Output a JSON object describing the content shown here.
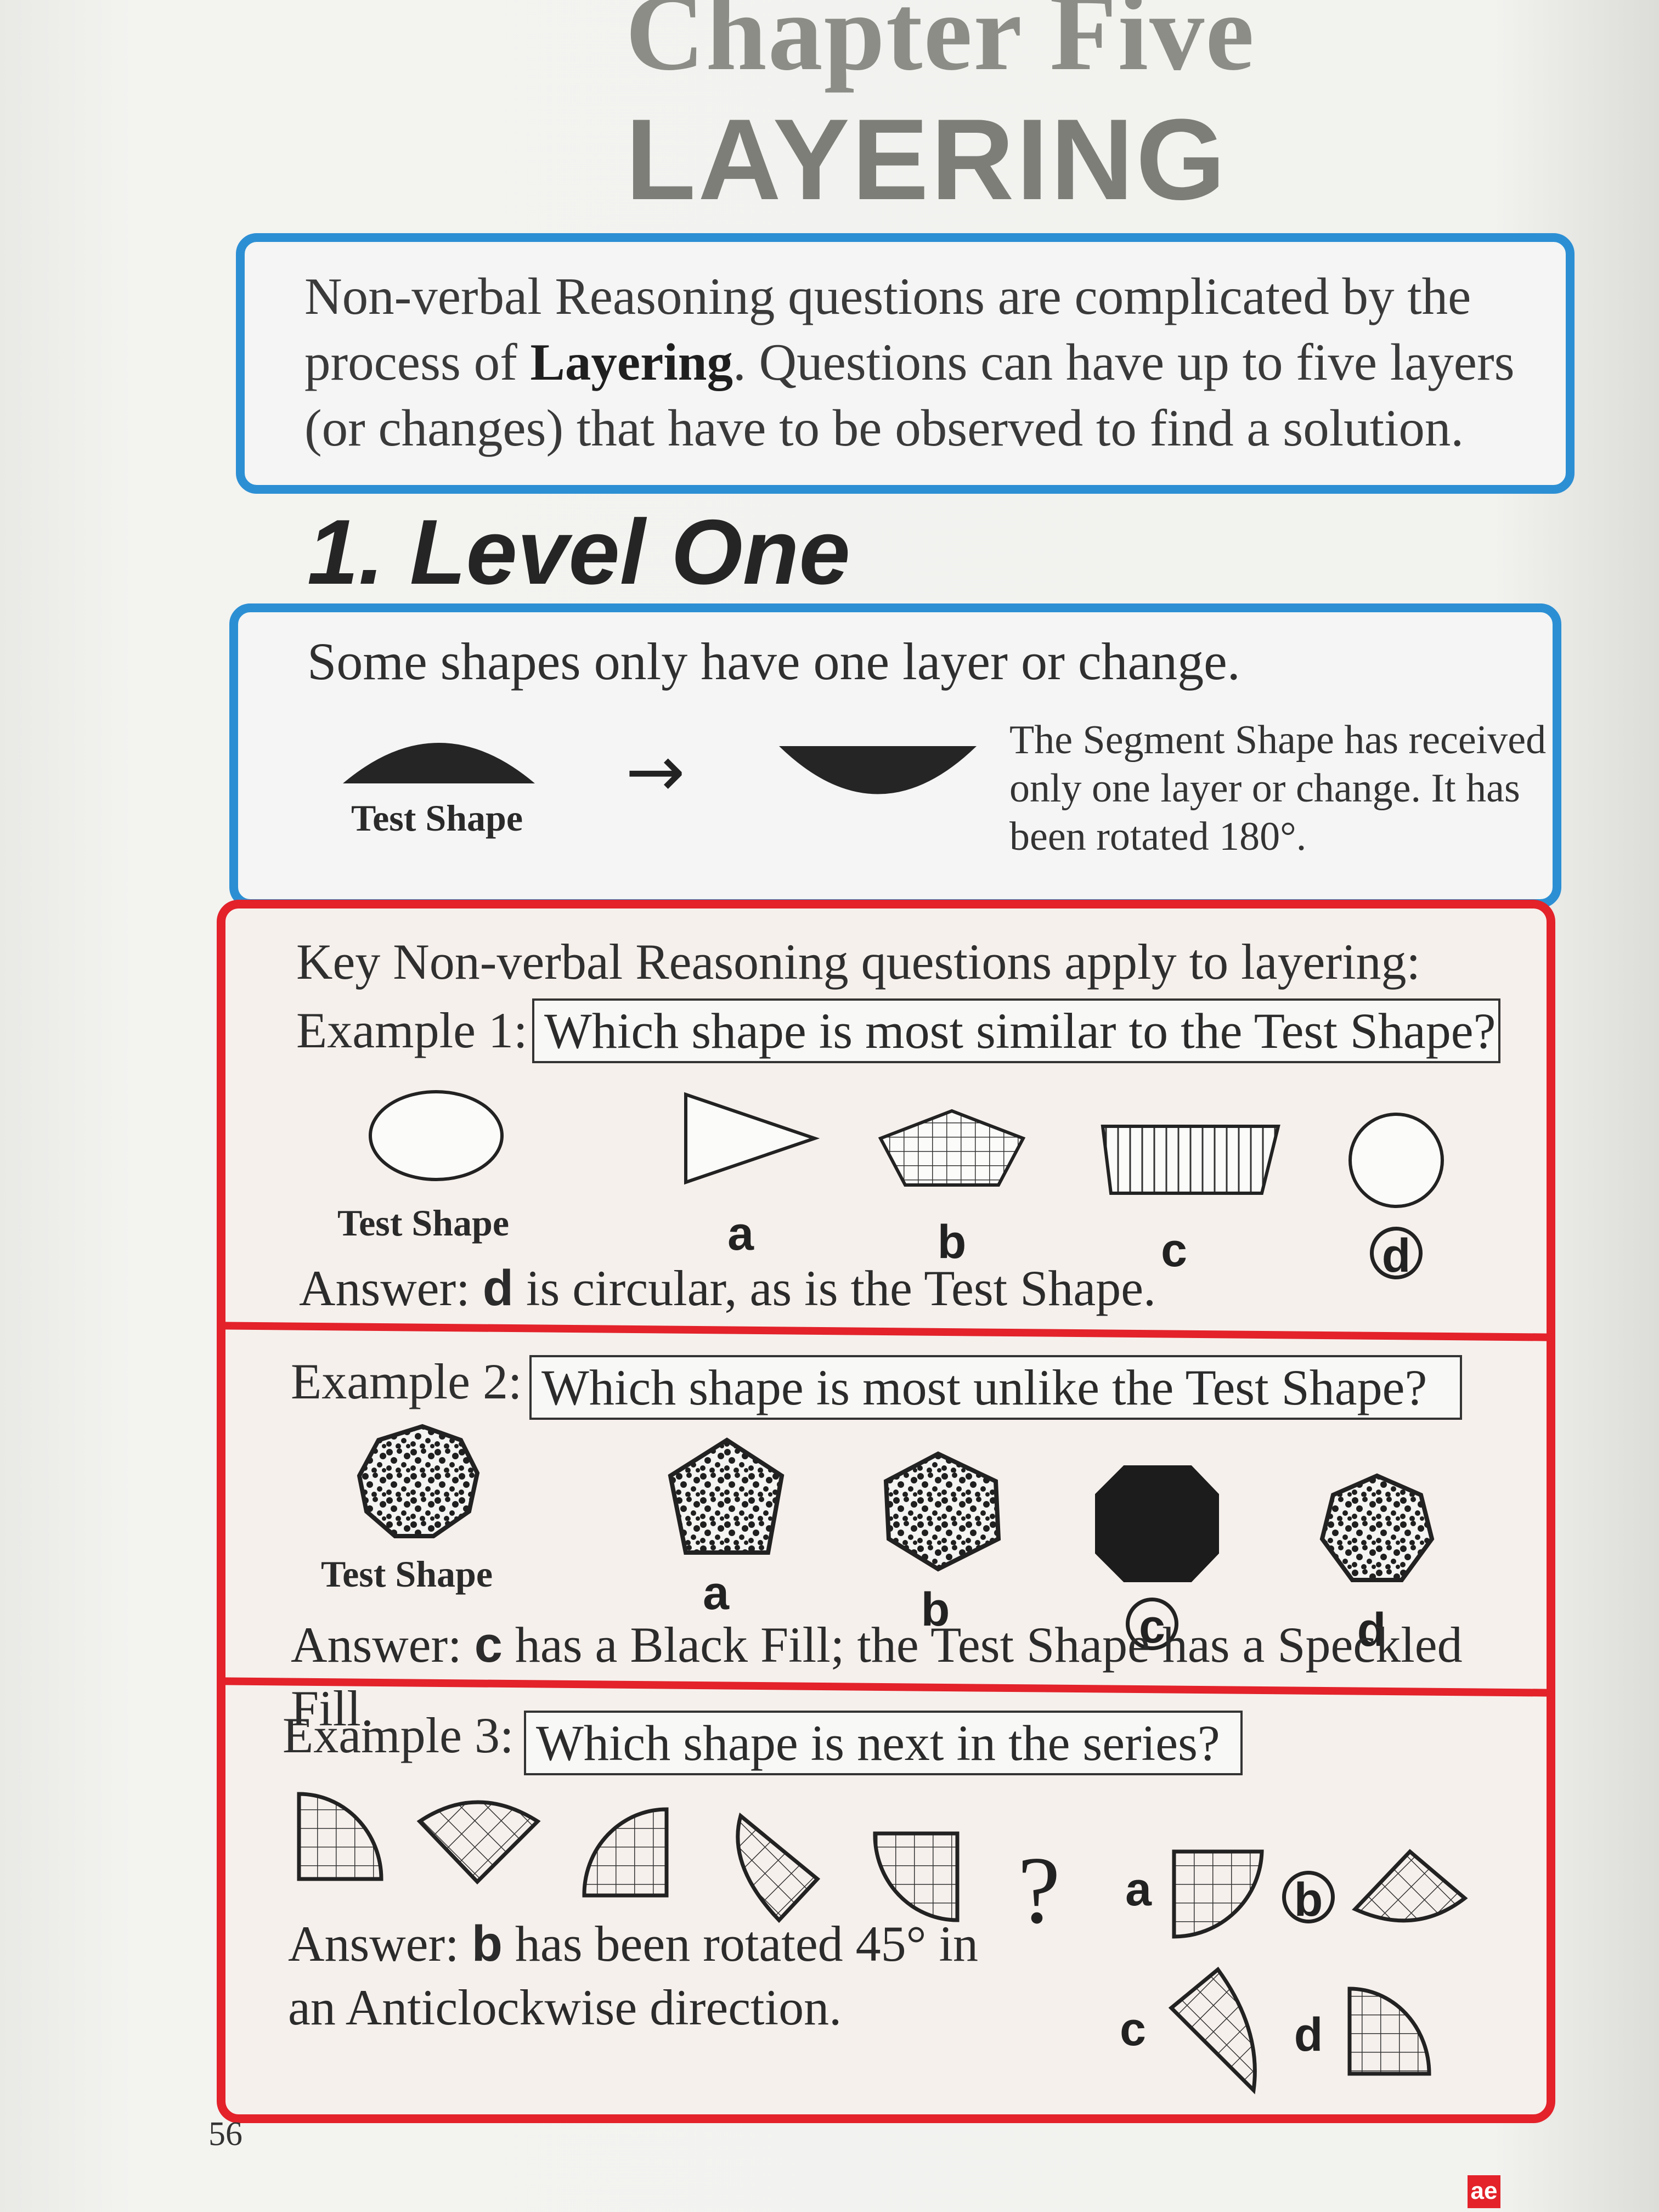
{
  "chapter": {
    "title": "Chapter Five",
    "subtitle": "LAYERING"
  },
  "intro": {
    "text_before": "Non-verbal Reasoning questions are complicated by the process of ",
    "bold": "Layering",
    "text_after": ". Questions can have up to five layers (or changes) that have to be observed to find a solution."
  },
  "section": {
    "heading": "1. Level One",
    "lead": "Some shapes only have one layer or change.",
    "test_shape_label": "Test Shape",
    "arrow": "→",
    "explanation": "The Segment Shape has received only one layer or change. It has been rotated 180°."
  },
  "key": {
    "lead": "Key Non-verbal Reasoning questions apply to layering:"
  },
  "examples": [
    {
      "label": "Example 1:",
      "question": "Which shape is most similar to the Test Shape?",
      "test_shape_label": "Test Shape",
      "options": [
        "a",
        "b",
        "c",
        "d"
      ],
      "correct": "d",
      "answer_label": "Answer:",
      "answer_letter": "d",
      "answer_text": " is circular, as is the Test Shape."
    },
    {
      "label": "Example 2:",
      "question": "Which shape is most unlike the Test Shape?",
      "test_shape_label": "Test Shape",
      "options": [
        "a",
        "b",
        "c",
        "d"
      ],
      "correct": "c",
      "answer_label": "Answer:",
      "answer_letter": "c",
      "answer_text": " has a Black Fill; the Test Shape has a Speckled Fill."
    },
    {
      "label": "Example 3:",
      "question": "Which shape is next in the series?",
      "series_gap": "?",
      "options": [
        "a",
        "b",
        "c",
        "d"
      ],
      "correct": "b",
      "answer_label": "Answer:",
      "answer_letter": "b",
      "answer_text": " has been rotated 45° in an Anticlockwise direction."
    }
  ],
  "footer": {
    "page_number": "56",
    "logo": "ae"
  },
  "colors": {
    "blue_border": "#2c8fd4",
    "red_border": "#e3222a",
    "title_grey": "#8d8d88"
  }
}
